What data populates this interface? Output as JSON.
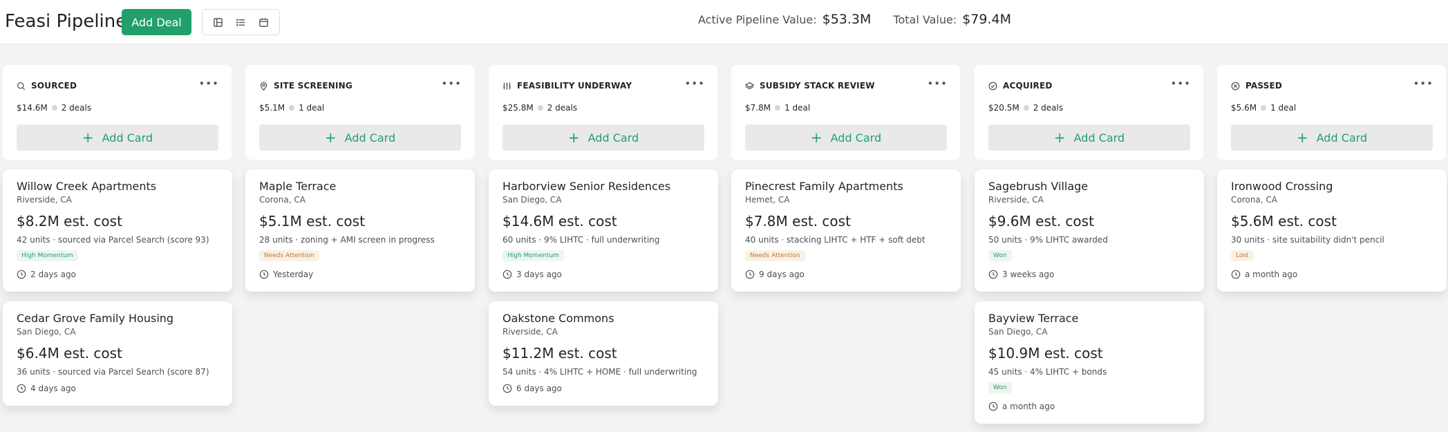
{
  "header": {
    "title": "Feasi Pipeline",
    "add_deal_label": "Add Deal",
    "active_pipeline_label": "Active Pipeline Value:",
    "active_pipeline_value": "$53.3M",
    "total_value_label": "Total Value:",
    "total_value": "$79.4M",
    "view_icons": [
      "board-view-icon",
      "list-view-icon",
      "calendar-view-icon"
    ]
  },
  "add_card_label": "Add Card",
  "columns": [
    {
      "name": "SOURCED",
      "icon": "search-icon",
      "value": "$14.6M",
      "count": "2 deals",
      "cards": [
        {
          "name": "Willow Creek Apartments",
          "location": "Riverside, CA",
          "cost": "$8.2M est. cost",
          "details": "42 units · sourced via Parcel Search (score 93)",
          "badge": "High Momentum",
          "time": "2 days ago"
        },
        {
          "name": "Cedar Grove Family Housing",
          "location": "San Diego, CA",
          "cost": "$6.4M est. cost",
          "details": "36 units · sourced via Parcel Search (score 87)",
          "badge": "",
          "time": "4 days ago"
        }
      ]
    },
    {
      "name": "SITE SCREENING",
      "icon": "map-pin-icon",
      "value": "$5.1M",
      "count": "1 deal",
      "cards": [
        {
          "name": "Maple Terrace",
          "location": "Corona, CA",
          "cost": "$5.1M est. cost",
          "details": "28 units · zoning + AMI screen in progress",
          "badge": "Needs Attention",
          "time": "Yesterday"
        }
      ]
    },
    {
      "name": "FEASIBILITY UNDERWAY",
      "icon": "sliders-icon",
      "value": "$25.8M",
      "count": "2 deals",
      "cards": [
        {
          "name": "Harborview Senior Residences",
          "location": "San Diego, CA",
          "cost": "$14.6M est. cost",
          "details": "60 units · 9% LIHTC · full underwriting",
          "badge": "High Momentum",
          "time": "3 days ago"
        },
        {
          "name": "Oakstone Commons",
          "location": "Riverside, CA",
          "cost": "$11.2M est. cost",
          "details": "54 units · 4% LIHTC + HOME · full underwriting",
          "badge": "",
          "time": "6 days ago"
        }
      ]
    },
    {
      "name": "SUBSIDY STACK REVIEW",
      "icon": "layers-icon",
      "value": "$7.8M",
      "count": "1 deal",
      "cards": [
        {
          "name": "Pinecrest Family Apartments",
          "location": "Hemet, CA",
          "cost": "$7.8M est. cost",
          "details": "40 units · stacking LIHTC + HTF + soft debt",
          "badge": "Needs Attention",
          "time": "9 days ago"
        }
      ]
    },
    {
      "name": "ACQUIRED",
      "icon": "check-circle-icon",
      "value": "$20.5M",
      "count": "2 deals",
      "cards": [
        {
          "name": "Sagebrush Village",
          "location": "Riverside, CA",
          "cost": "$9.6M est. cost",
          "details": "50 units · 9% LIHTC awarded",
          "badge": "Won",
          "time": "3 weeks ago"
        },
        {
          "name": "Bayview Terrace",
          "location": "San Diego, CA",
          "cost": "$10.9M est. cost",
          "details": "45 units · 4% LIHTC + bonds",
          "badge": "Won",
          "time": "a month ago"
        }
      ]
    },
    {
      "name": "PASSED",
      "icon": "x-circle-icon",
      "value": "$5.6M",
      "count": "1 deal",
      "cards": [
        {
          "name": "Ironwood Crossing",
          "location": "Corona, CA",
          "cost": "$5.6M est. cost",
          "details": "30 units · site suitability didn't pencil",
          "badge": "Lost",
          "time": "a month ago"
        }
      ]
    }
  ],
  "colors": {
    "accent": "#22a06b",
    "badge_green": "#22a06b",
    "badge_orange": "#c47a1c",
    "background": "#f3f3f2"
  }
}
